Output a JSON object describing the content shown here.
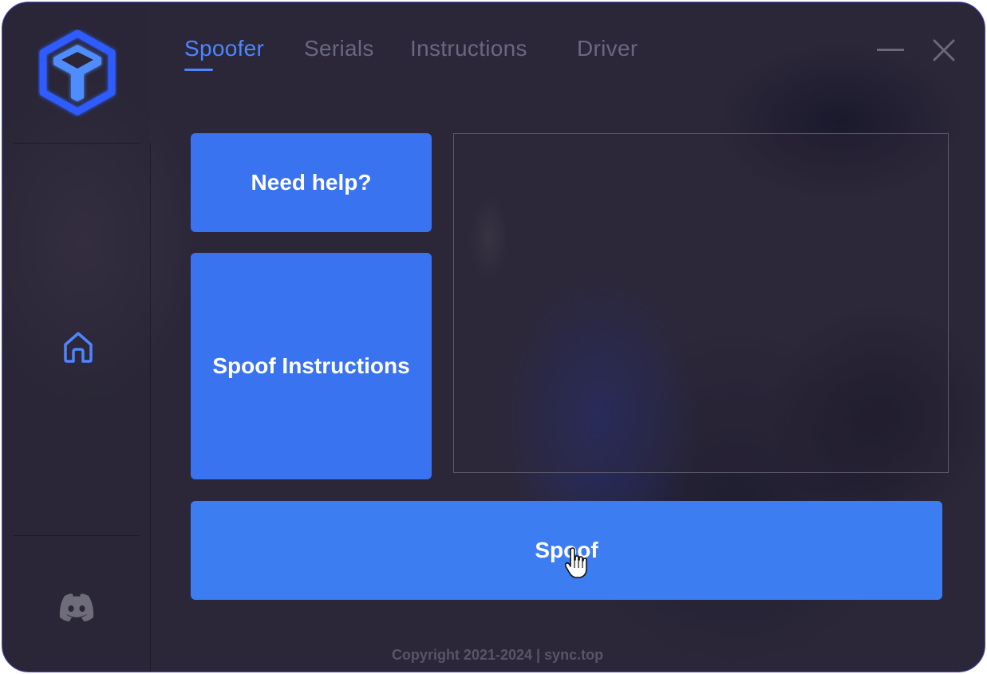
{
  "tabs": [
    {
      "label": "Spoofer",
      "active": true
    },
    {
      "label": "Serials",
      "active": false
    },
    {
      "label": "Instructions",
      "active": false
    },
    {
      "label": "Driver",
      "active": false
    }
  ],
  "buttons": {
    "help": "Need help?",
    "instructions": "Spoof Instructions",
    "spoof": "Spoof"
  },
  "footer": "Copyright 2021-2024 | sync.top",
  "sidebar": {
    "icons": [
      "logo-icon",
      "home-icon",
      "discord-icon"
    ]
  },
  "window_controls": [
    "minimize-icon",
    "close-icon"
  ],
  "colors": {
    "accent": "#3a73ef",
    "active_tab": "#4d86ff",
    "background": "#2b2739"
  }
}
